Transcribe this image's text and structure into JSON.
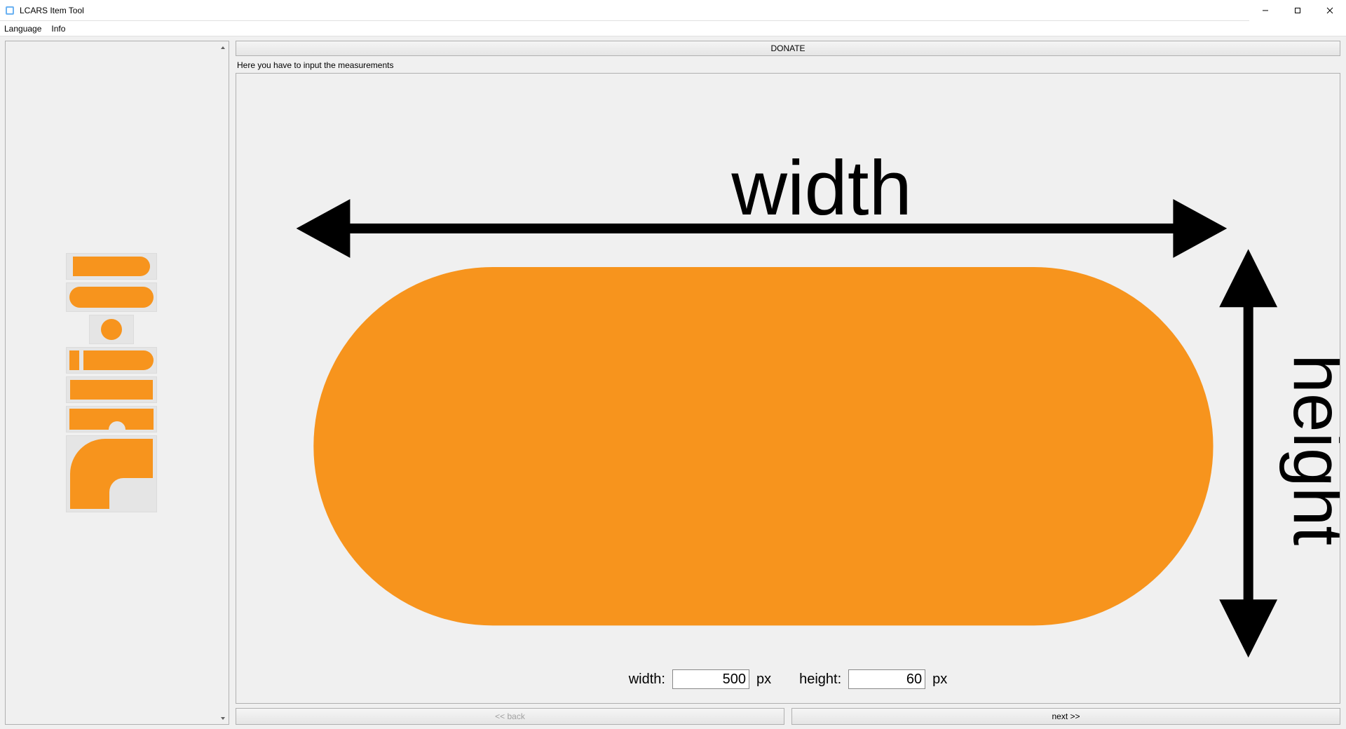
{
  "window": {
    "title": "LCARS Item Tool"
  },
  "menubar": {
    "language": "Language",
    "info": "Info"
  },
  "main": {
    "donate": "DONATE",
    "instruction": "Here you have to input the measurements",
    "diagram": {
      "width_label": "width",
      "height_label": "height"
    },
    "inputs": {
      "width_label": "width:",
      "width_value": "500",
      "width_unit": "px",
      "height_label": "height:",
      "height_value": "60",
      "height_unit": "px"
    }
  },
  "nav": {
    "back": "<< back",
    "next": "next >>"
  },
  "colors": {
    "shape": "#f7941d"
  }
}
